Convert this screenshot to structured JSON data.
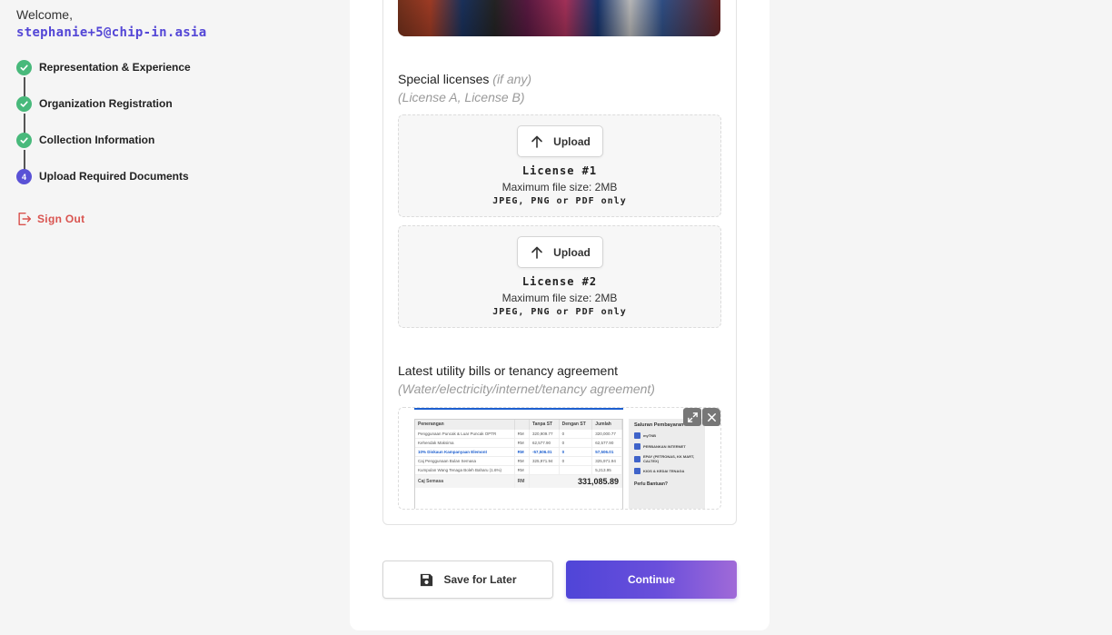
{
  "sidebar": {
    "welcome": "Welcome,",
    "email": "stephanie+5@chip-in.asia",
    "steps": [
      {
        "label": "Representation & Experience",
        "status": "done"
      },
      {
        "label": "Organization Registration",
        "status": "done"
      },
      {
        "label": "Collection Information",
        "status": "done"
      },
      {
        "label": "Upload Required Documents",
        "status": "current",
        "number": "4"
      }
    ],
    "signout_label": "Sign Out"
  },
  "colors": {
    "accent": "#5346d6",
    "success": "#48b97b",
    "danger": "#d9534f"
  },
  "special_licenses": {
    "title": "Special licenses",
    "optional": "(if any)",
    "subtitle": "(License A, License B)",
    "items": [
      {
        "upload_label": "Upload",
        "name": "License #1",
        "max_size": "Maximum file size: 2MB",
        "types": "JPEG, PNG or PDF only"
      },
      {
        "upload_label": "Upload",
        "name": "License #2",
        "max_size": "Maximum file size: 2MB",
        "types": "JPEG, PNG or PDF only"
      }
    ]
  },
  "utility": {
    "title": "Latest utility bills or tenancy agreement",
    "subtitle": "(Water/electricity/internet/tenancy agreement)",
    "bill": {
      "headers": [
        "Penerangan",
        "",
        "Tanpa ST",
        "Dengan ST",
        "Jumlah"
      ],
      "rows": [
        [
          "Penggunaan Puncak & Luar Puncak OPTR",
          "RM",
          "320,909.77",
          "0",
          "320,000.77"
        ],
        [
          "Kehendak Maksima",
          "RM",
          "62,577.90",
          "0",
          "62,577.90"
        ],
        [
          "10% Diskaun Kampanyaan Elemont",
          "RM",
          "-57,506.01",
          "0",
          "57,506.01"
        ],
        [
          "Caj Penggunaan Bulan Semasa",
          "RM",
          "325,971.94",
          "0",
          "325,971.94"
        ],
        [
          "Kumpulan Wang Tenaga Boleh Baharu (1.6%)",
          "RM",
          "",
          "",
          "5,213.95"
        ]
      ],
      "total_label": "Caj Semasa",
      "total_currency": "RM",
      "total_amount": "331,085.89",
      "panel_title": "Saluran Pembayaran",
      "panel_items": [
        "myTNB",
        "PERBANKAN INTERNET",
        "EPAY (PETRONAS, KK MART, CALTEX)",
        "KIOS & KEDAI TENAGA"
      ],
      "panel_help": "Perlu Bantuan?"
    }
  },
  "actions": {
    "save_label": "Save for Later",
    "continue_label": "Continue"
  }
}
